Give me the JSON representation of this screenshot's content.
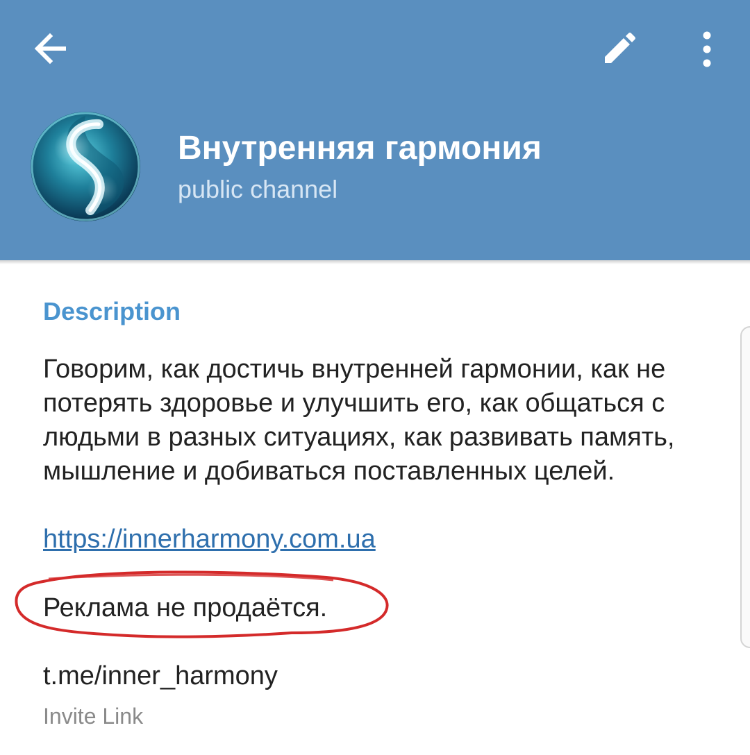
{
  "header": {
    "title": "Внутренняя гармония",
    "subtitle": "public channel",
    "background_color": "#5a8fbf",
    "back_icon": "arrow-left-icon",
    "edit_icon": "pencil-icon",
    "more_icon": "more-vertical-icon"
  },
  "info": {
    "description_label": "Description",
    "description_text": "Говорим, как достичь внутренней гармонии, как не потерять здоровье и улучшить его, как общаться с людьми в разных ситуациях, как развивать память, мышление и добиваться поставленных целей.",
    "description_link": "https://innerharmony.com.ua",
    "ad_notice": "Реклама не продаётся.",
    "invite_link": "t.me/inner_harmony",
    "invite_label": "Invite Link",
    "label_color": "#4a94cf",
    "link_color": "#2e6fad",
    "annotation_color": "#d42a2a"
  }
}
